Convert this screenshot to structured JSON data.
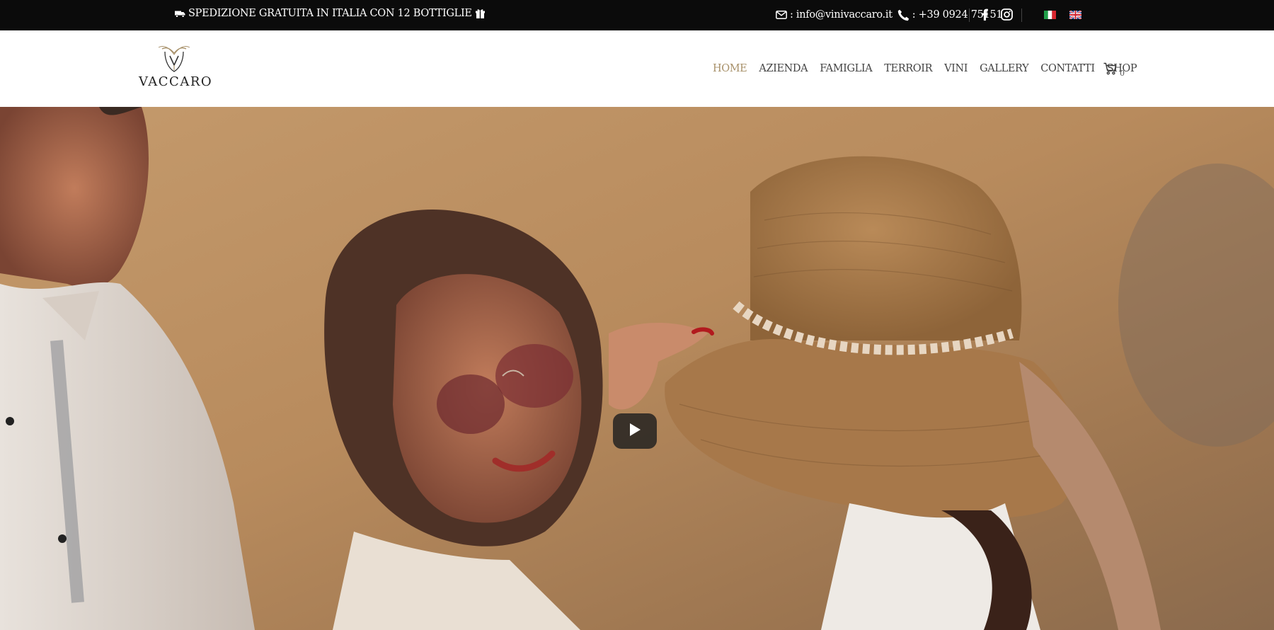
{
  "topbar": {
    "shipping_text": "SPEDIZIONE GRATUITA IN ITALIA CON 12 BOTTIGLIE",
    "shipping_icon": "truck-icon",
    "gift_icon": "gift-icon",
    "email_label": ": info@vinivaccaro.it",
    "phone_label": ": +39 0924 75151",
    "social": [
      "facebook-icon",
      "instagram-icon"
    ],
    "languages": [
      "it",
      "en"
    ]
  },
  "header": {
    "logo_text": "VACCARO",
    "nav": [
      "HOME",
      "AZIENDA",
      "FAMIGLIA",
      "TERROIR",
      "VINI",
      "GALLERY",
      "CONTATTI",
      "SHOP"
    ],
    "active_nav": "HOME",
    "cart_count": "0"
  },
  "hero": {
    "play_icon": "play-icon"
  },
  "colors": {
    "topbar_bg": "#0b0b0b",
    "nav_active": "#a8916a",
    "nav_text": "#444444",
    "hero_tone": "#b48a5f"
  }
}
